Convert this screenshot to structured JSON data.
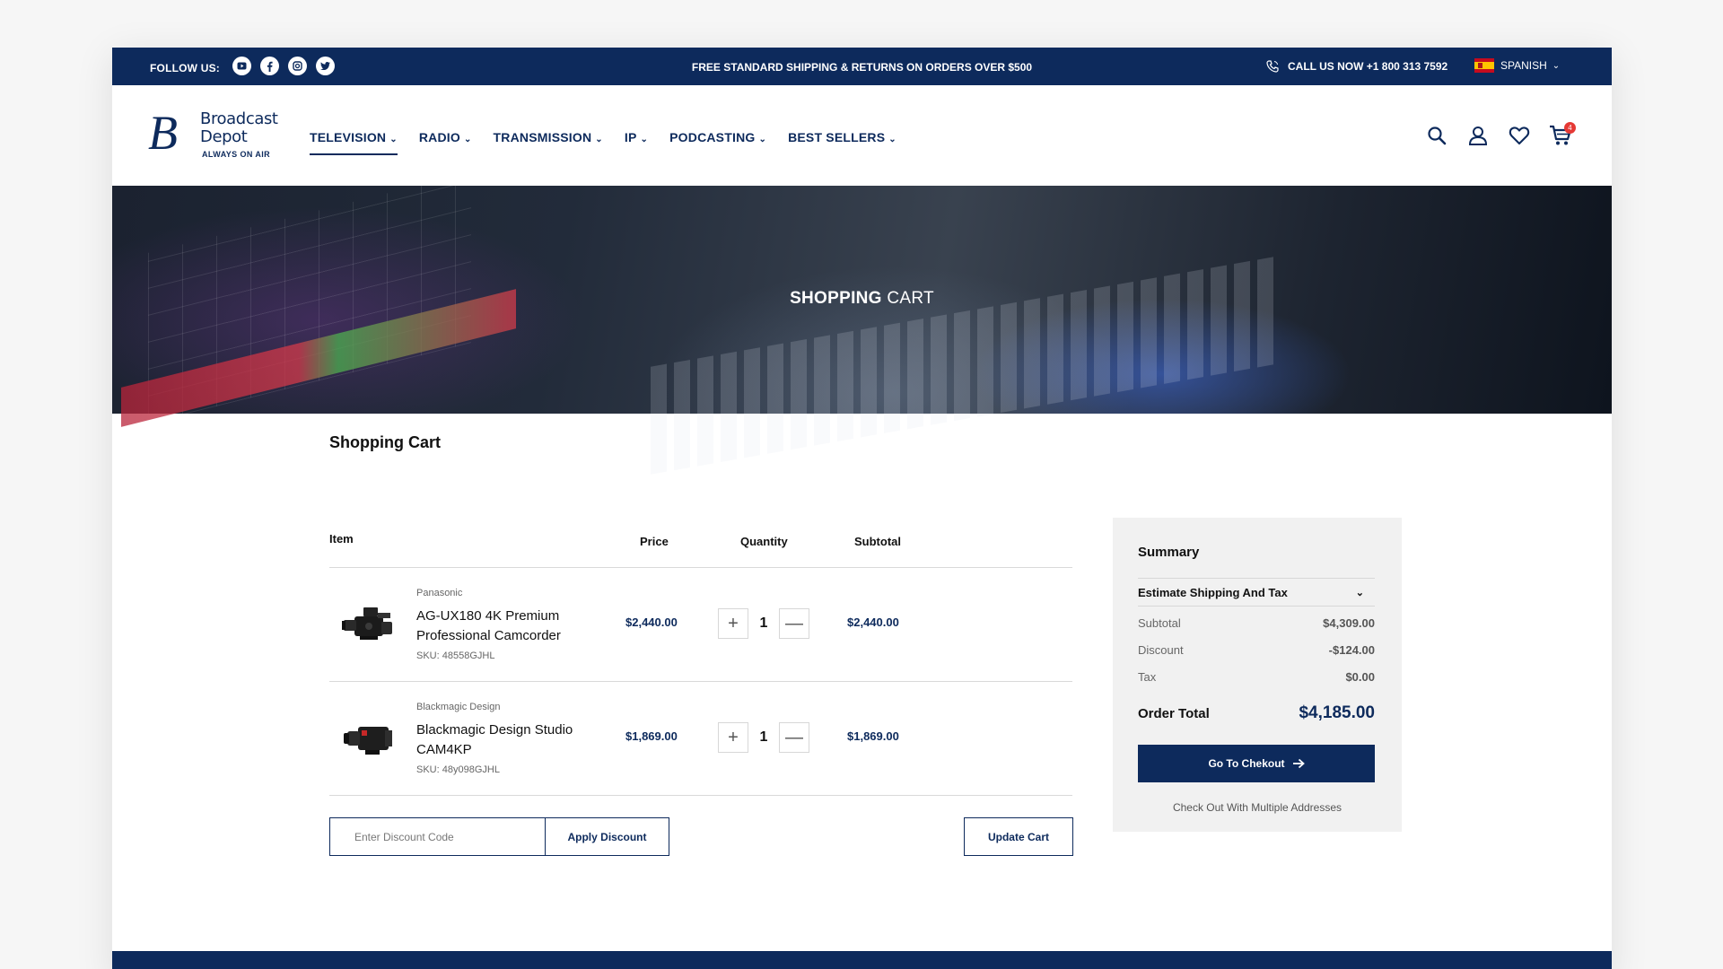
{
  "topbar": {
    "follow_label": "FOLLOW US:",
    "social_icons": [
      "youtube-icon",
      "facebook-icon",
      "instagram-icon",
      "twitter-icon"
    ],
    "promo": "FREE STANDARD SHIPPING & RETURNS ON ORDERS OVER $500",
    "call": "CALL US NOW +1 800 313 7592",
    "language": "SPANISH"
  },
  "logo": {
    "name_line1": "Broadcast",
    "name_line2": "Depot",
    "tagline": "ALWAYS ON AIR"
  },
  "nav": [
    {
      "label": "TELEVISION",
      "active": true
    },
    {
      "label": "RADIO"
    },
    {
      "label": "TRANSMISSION"
    },
    {
      "label": "IP"
    },
    {
      "label": "PODCASTING"
    },
    {
      "label": "BEST SELLERS"
    }
  ],
  "header_icons": {
    "cart_count": "4"
  },
  "hero": {
    "title_bold": "SHOPPING",
    "title_light": "CART"
  },
  "page_title": "Shopping Cart",
  "table": {
    "headers": {
      "item": "Item",
      "price": "Price",
      "quantity": "Quantity",
      "subtotal": "Subtotal"
    },
    "items": [
      {
        "brand": "Panasonic",
        "name": "AG-UX180 4K Premium Professional Camcorder",
        "sku": "SKU: 48558GJHL",
        "price": "$2,440.00",
        "qty": "1",
        "subtotal": "$2,440.00"
      },
      {
        "brand": "Blackmagic Design",
        "name": "Blackmagic Design Studio CAM4KP",
        "sku": "SKU: 48y098GJHL",
        "price": "$1,869.00",
        "qty": "1",
        "subtotal": "$1,869.00"
      }
    ]
  },
  "discount": {
    "placeholder": "Enter Discount Code",
    "apply_label": "Apply Discount"
  },
  "update_label": "Update Cart",
  "summary": {
    "title": "Summary",
    "estimate_label": "Estimate Shipping And Tax",
    "rows": [
      {
        "label": "Subtotal",
        "value": "$4,309.00"
      },
      {
        "label": "Discount",
        "value": "-$124.00"
      },
      {
        "label": "Tax",
        "value": "$0.00"
      }
    ],
    "total_label": "Order Total",
    "total_value": "$4,185.00",
    "checkout_label": "Go To Chekout",
    "multi_label": "Check Out With Multiple Addresses"
  },
  "colors": {
    "brand_navy": "#0d2a5c",
    "badge_red": "#e53935",
    "summary_bg": "#f1f1f1"
  }
}
